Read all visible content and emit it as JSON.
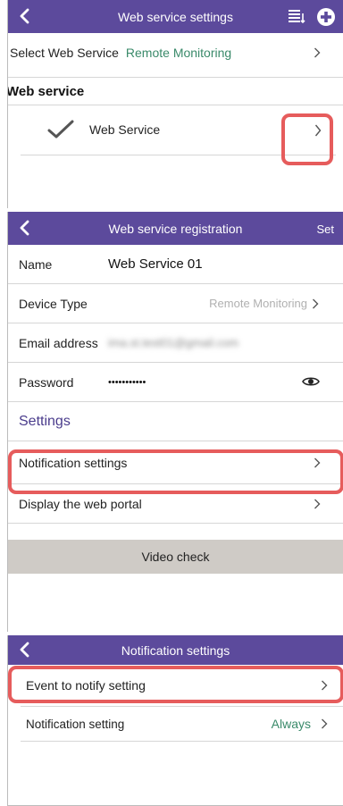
{
  "screen1": {
    "title": "Web service settings",
    "select_label": "Select Web Service",
    "select_value": "Remote Monitoring",
    "section_title": "Web service",
    "service_item": "Web Service"
  },
  "screen2": {
    "title": "Web service registration",
    "set_label": "Set",
    "name_label": "Name",
    "name_value": "Web Service 01",
    "device_type_label": "Device Type",
    "device_type_value": "Remote Monitoring",
    "email_label": "Email address",
    "email_value": "ima.st.test01@gmail.com",
    "password_label": "Password",
    "password_value": "•••••••••••",
    "settings_heading": "Settings",
    "notification_settings": "Notification settings",
    "display_portal": "Display the web portal",
    "video_check": "Video check"
  },
  "screen3": {
    "title": "Notification settings",
    "event_notify": "Event to notify setting",
    "notification_setting_label": "Notification setting",
    "notification_setting_value": "Always"
  },
  "colors": {
    "topbar": "#5c4a9c",
    "accent_green": "#3a8a6a",
    "settings_heading": "#4a3c8c",
    "highlight": "#e65c5c",
    "video_button_bg": "#cfcbc6"
  }
}
